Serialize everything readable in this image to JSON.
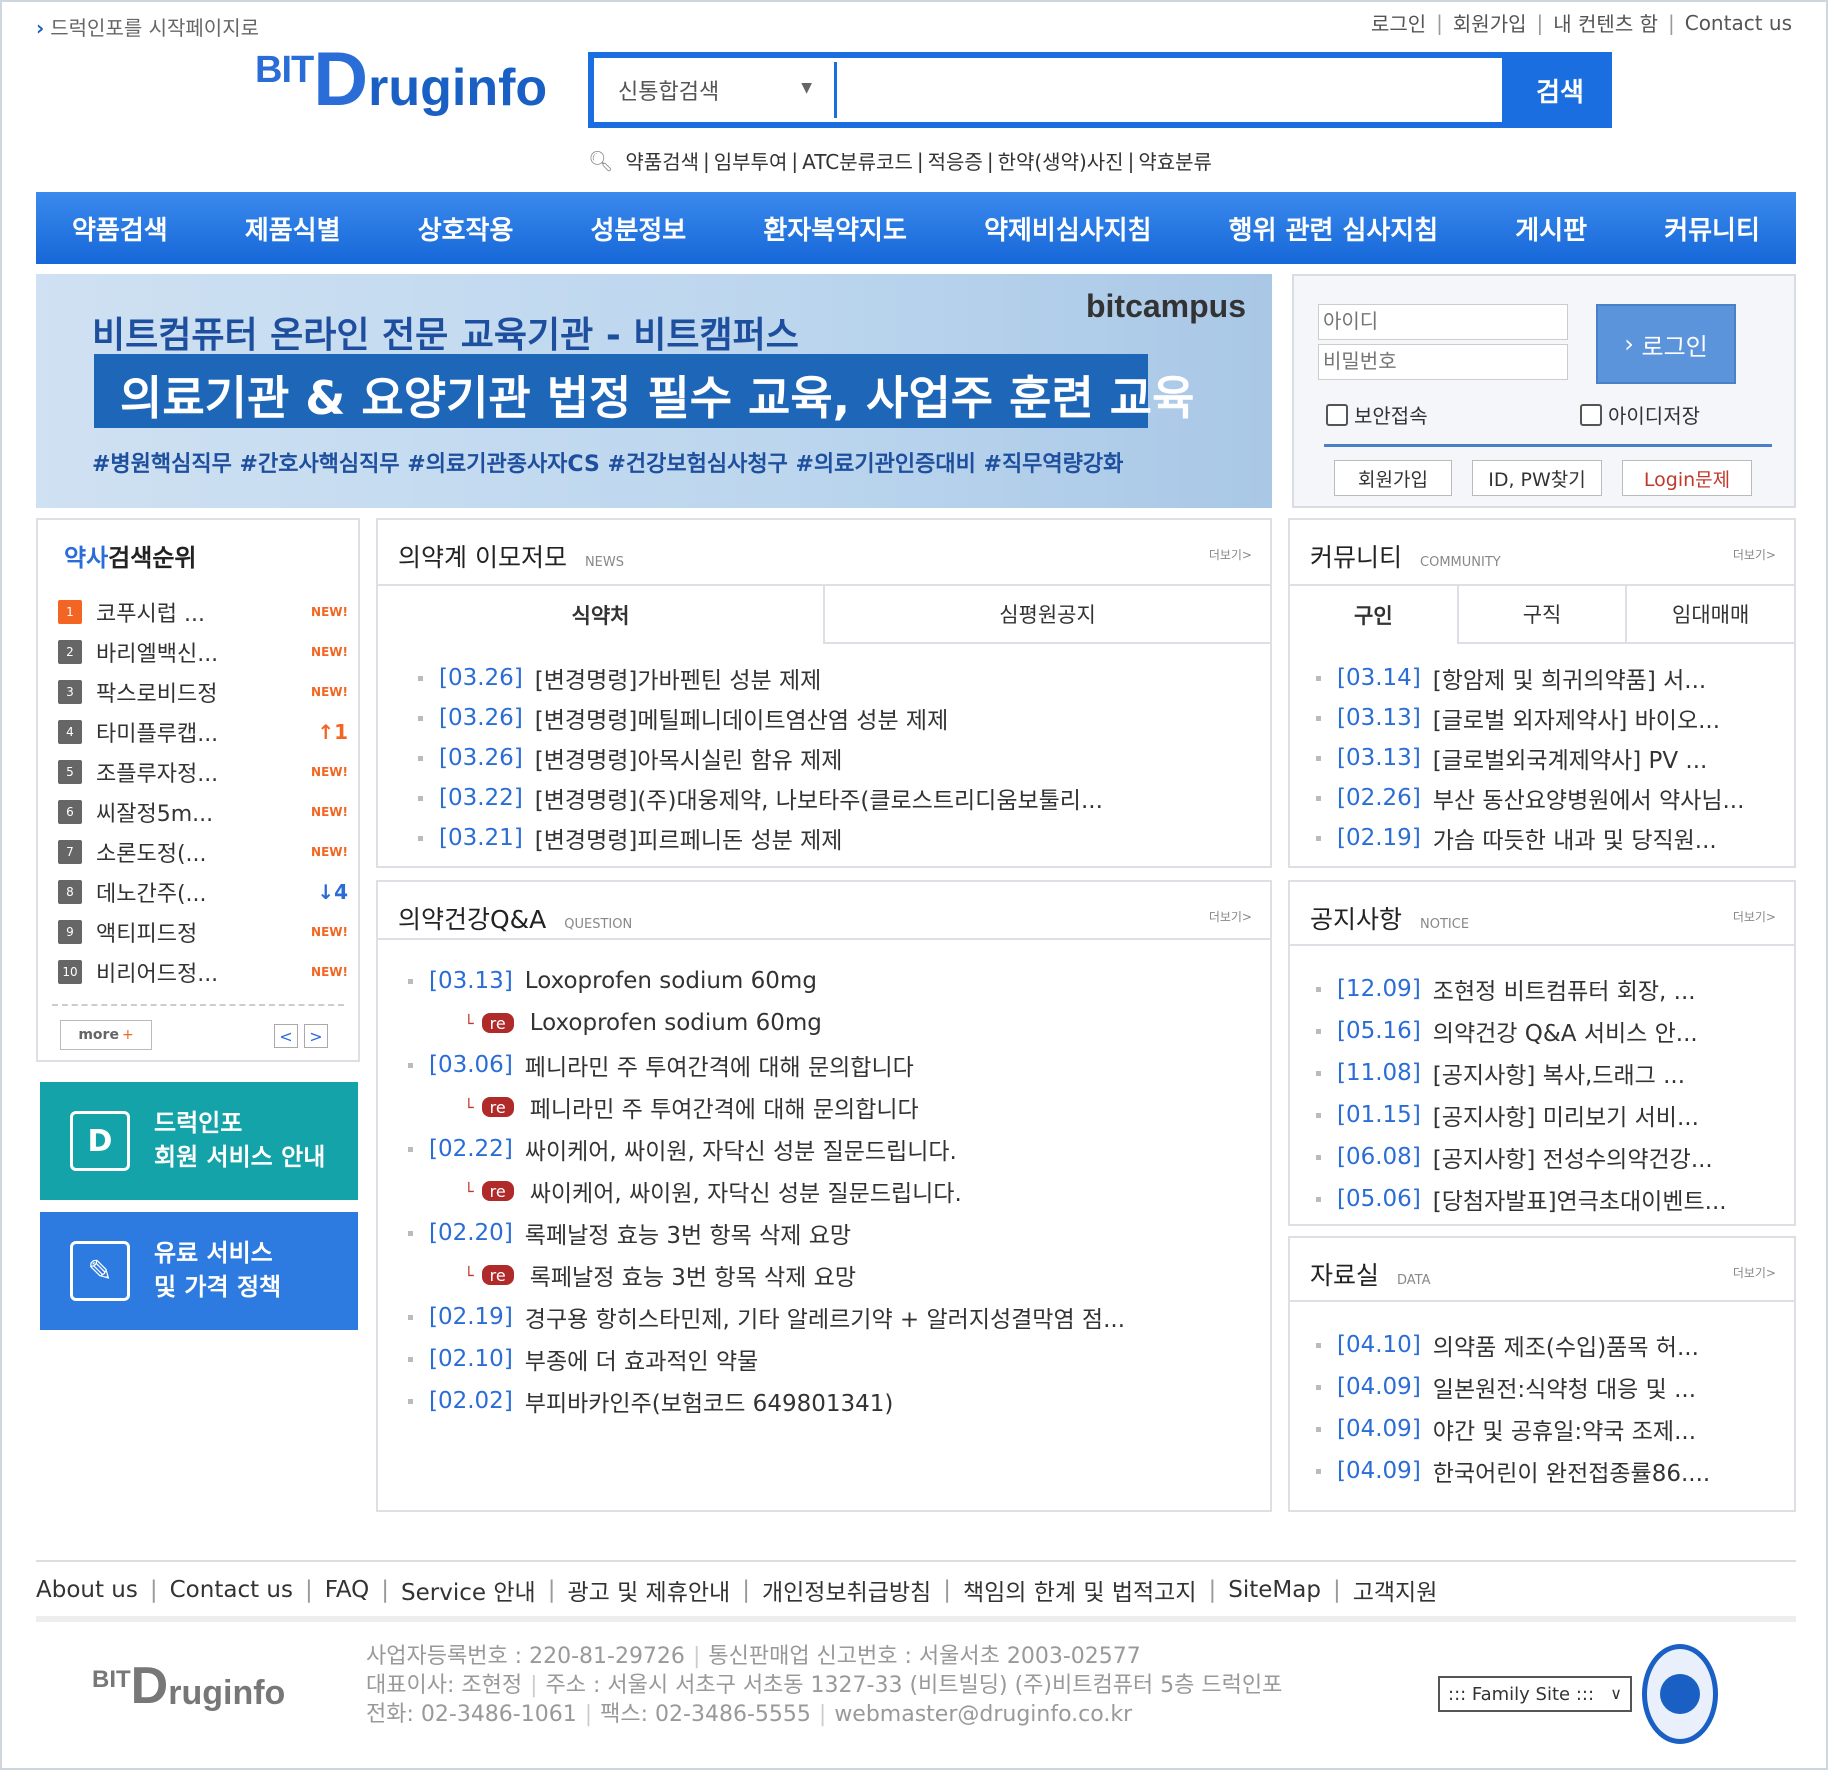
{
  "top": {
    "start_page": "드럭인포를 시작페이지로",
    "links": [
      "로그인",
      "회원가입",
      "내 컨텐츠 함",
      "Contact us"
    ]
  },
  "logo": {
    "bit": "BIT",
    "d": "D",
    "rest": "ruginfo"
  },
  "search": {
    "category": "신통합검색",
    "value": "",
    "button": "검색",
    "quicklinks": [
      "약품검색",
      "임부투여",
      "ATC분류코드",
      "적응증",
      "한약(생약)사진",
      "약효분류"
    ]
  },
  "nav": [
    "약품검색",
    "제품식별",
    "상호작용",
    "성분정보",
    "환자복약지도",
    "약제비심사지침",
    "행위 관련 심사지침",
    "게시판",
    "커뮤니티"
  ],
  "banner": {
    "brand": "bitcampus",
    "line1": "비트컴퓨터 온라인 전문 교육기관 - 비트캠퍼스",
    "line2": "의료기관 & 요양기관 법정 필수 교육, 사업주 훈련 교육",
    "line3": "#병원핵심직무 #간호사핵심직무 #의료기관종사자CS #건강보험심사청구 #의료기관인증대비 #직무역량강화"
  },
  "login": {
    "id_placeholder": "아이디",
    "pw_placeholder": "비밀번호",
    "button": "로그인",
    "secure": "보안접속",
    "save_id": "아이디저장",
    "join": "회원가입",
    "find": "ID, PW찾기",
    "problem": "Login문제"
  },
  "ranking": {
    "title_strong": "약사",
    "title_rest": "검색순위",
    "items": [
      {
        "num": "1",
        "name": "코푸시럽 ...",
        "badge": "NEW!",
        "type": "new"
      },
      {
        "num": "2",
        "name": "바리엘백신...",
        "badge": "NEW!",
        "type": "new"
      },
      {
        "num": "3",
        "name": "팍스로비드정",
        "badge": "NEW!",
        "type": "new"
      },
      {
        "num": "4",
        "name": "타미플루캡...",
        "badge": "↑1",
        "type": "up"
      },
      {
        "num": "5",
        "name": "조플루자정...",
        "badge": "NEW!",
        "type": "new"
      },
      {
        "num": "6",
        "name": "씨잘정5m...",
        "badge": "NEW!",
        "type": "new"
      },
      {
        "num": "7",
        "name": "소론도정(...",
        "badge": "NEW!",
        "type": "new"
      },
      {
        "num": "8",
        "name": "데노간주(...",
        "badge": "↓4",
        "type": "down"
      },
      {
        "num": "9",
        "name": "액티피드정",
        "badge": "NEW!",
        "type": "new"
      },
      {
        "num": "10",
        "name": "비리어드정...",
        "badge": "NEW!",
        "type": "new"
      }
    ],
    "more": "more",
    "more_plus": "+",
    "prev": "<",
    "next": ">"
  },
  "side_banners": [
    {
      "line1": "드럭인포",
      "line2": "회원 서비스 안내",
      "color": "#13a3a8"
    },
    {
      "line1": "유료 서비스",
      "line2": "및 가격 정책",
      "color": "#2d7be0"
    }
  ],
  "news": {
    "title": "의약계 이모저모",
    "sub": "NEWS",
    "more": "더보기>",
    "tabs": [
      "식약처",
      "심평원공지"
    ],
    "items": [
      {
        "date": "[03.26]",
        "text": "[변경명령]가바펜틴 성분 제제"
      },
      {
        "date": "[03.26]",
        "text": "[변경명령]메틸페니데이트염산염 성분 제제"
      },
      {
        "date": "[03.26]",
        "text": "[변경명령]아목시실린 함유 제제"
      },
      {
        "date": "[03.22]",
        "text": "[변경명령](주)대웅제약, 나보타주(클로스트리디움보툴리..."
      },
      {
        "date": "[03.21]",
        "text": "[변경명령]피르페니돈 성분 제제"
      }
    ]
  },
  "qna": {
    "title": "의약건강Q&A",
    "sub": "QUESTION",
    "more": "더보기>",
    "reply_tag": "re",
    "items": [
      {
        "date": "[03.13]",
        "text": "Loxoprofen sodium 60mg",
        "reply": "Loxoprofen sodium 60mg"
      },
      {
        "date": "[03.06]",
        "text": "페니라민 주 투여간격에 대해 문의합니다",
        "reply": "페니라민 주 투여간격에 대해 문의합니다"
      },
      {
        "date": "[02.22]",
        "text": "싸이케어, 싸이원, 자닥신 성분 질문드립니다.",
        "reply": "싸이케어, 싸이원, 자닥신 성분 질문드립니다."
      },
      {
        "date": "[02.20]",
        "text": "록페날정 효능 3번 항목 삭제 요망",
        "reply": "록페날정 효능 3번 항목 삭제 요망"
      },
      {
        "date": "[02.19]",
        "text": "경구용 항히스타민제, 기타 알레르기약 + 알러지성결막염 점...",
        "reply": null
      },
      {
        "date": "[02.10]",
        "text": "부종에 더 효과적인 약물",
        "reply": null
      },
      {
        "date": "[02.02]",
        "text": "부피바카인주(보험코드 649801341)",
        "reply": null
      }
    ]
  },
  "community": {
    "title": "커뮤니티",
    "sub": "COMMUNITY",
    "more": "더보기>",
    "tabs": [
      "구인",
      "구직",
      "임대매매"
    ],
    "items": [
      {
        "date": "[03.14]",
        "text": "[항암제 및 희귀의약품] 서..."
      },
      {
        "date": "[03.13]",
        "text": "[글로벌 외자제약사] 바이오..."
      },
      {
        "date": "[03.13]",
        "text": "[글로벌외국계제약사] PV ..."
      },
      {
        "date": "[02.26]",
        "text": "부산 동산요양병원에서 약사님..."
      },
      {
        "date": "[02.19]",
        "text": "가슴 따듯한 내과 및 당직원..."
      }
    ]
  },
  "notice": {
    "title": "공지사항",
    "sub": "NOTICE",
    "more": "더보기>",
    "items": [
      {
        "date": "[12.09]",
        "text": "조현정 비트컴퓨터 회장, ..."
      },
      {
        "date": "[05.16]",
        "text": "의약건강 Q&A 서비스 안..."
      },
      {
        "date": "[11.08]",
        "text": "[공지사항] 복사,드래그 ..."
      },
      {
        "date": "[01.15]",
        "text": "[공지사항] 미리보기 서비..."
      },
      {
        "date": "[06.08]",
        "text": "[공지사항] 전성수의약건강..."
      },
      {
        "date": "[05.06]",
        "text": "[당첨자발표]연극초대이벤트..."
      }
    ]
  },
  "data_room": {
    "title": "자료실",
    "sub": "DATA",
    "more": "더보기>",
    "items": [
      {
        "date": "[04.10]",
        "text": "의약품 제조(수입)품목 허..."
      },
      {
        "date": "[04.09]",
        "text": "일본원전:식약청 대응 및 ..."
      },
      {
        "date": "[04.09]",
        "text": "야간 및 공휴일:약국 조제..."
      },
      {
        "date": "[04.09]",
        "text": "한국어린이 완전접종률86...."
      }
    ]
  },
  "footer": {
    "links": [
      "About us",
      "Contact us",
      "FAQ",
      "Service 안내",
      "광고 및 제휴안내",
      "개인정보취급방침",
      "책임의 한계 및 법적고지",
      "SiteMap",
      "고객지원"
    ],
    "info1": [
      "사업자등록번호 : 220-81-29726",
      "통신판매업 신고번호 : 서울서초 2003-02577"
    ],
    "info2": [
      "대표이사: 조현정",
      "주소 : 서울시 서초구 서초동 1327-33 (비트빌딩) (주)비트컴퓨터 5층 드럭인포"
    ],
    "info3": [
      "전화: 02-3486-1061",
      "팩스: 02-3486-5555",
      "webmaster@druginfo.co.kr"
    ],
    "family_site": "::: Family Site :::",
    "caret": "∨"
  },
  "colors": {
    "primary": "#1a6ee0",
    "link_blue": "#2b6dd6",
    "accent_orange": "#f26522",
    "teal": "#13a3a8"
  }
}
